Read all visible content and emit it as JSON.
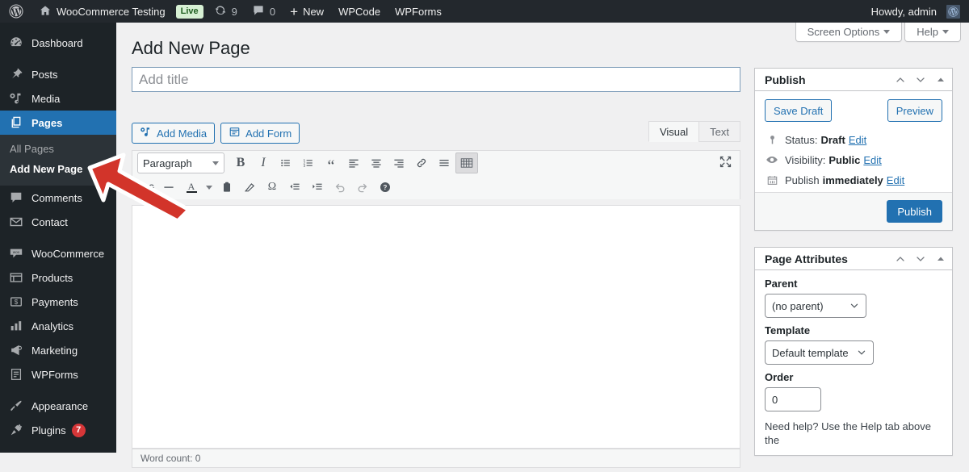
{
  "adminbar": {
    "wp_logo": "wordpress-logo-icon",
    "site_name": "WooCommerce Testing",
    "live_badge": "Live",
    "updates_icon": "updates-icon",
    "updates_count": "9",
    "comments_icon": "comment-bubble-icon",
    "comments_count": "0",
    "new_plus": "+",
    "new_label": "New",
    "wpcode_label": "WPCode",
    "wpforms_label": "WPForms",
    "howdy": "Howdy, admin",
    "avatar": "user-avatar"
  },
  "sidebar": {
    "items": [
      {
        "label": "Dashboard",
        "icon": "dashboard-icon",
        "current": false
      },
      {
        "label": "Posts",
        "icon": "pin-icon",
        "current": false
      },
      {
        "label": "Media",
        "icon": "media-icon",
        "current": false
      },
      {
        "label": "Pages",
        "icon": "pages-icon",
        "current": true
      },
      {
        "label": "Comments",
        "icon": "comment-icon",
        "current": false
      },
      {
        "label": "Contact",
        "icon": "envelope-icon",
        "current": false
      },
      {
        "label": "WooCommerce",
        "icon": "woocommerce-icon",
        "current": false
      },
      {
        "label": "Products",
        "icon": "products-icon",
        "current": false
      },
      {
        "label": "Payments",
        "icon": "payments-icon",
        "current": false
      },
      {
        "label": "Analytics",
        "icon": "analytics-icon",
        "current": false
      },
      {
        "label": "Marketing",
        "icon": "megaphone-icon",
        "current": false
      },
      {
        "label": "WPForms",
        "icon": "wpforms-icon",
        "current": false
      },
      {
        "label": "Appearance",
        "icon": "paintbrush-icon",
        "current": false
      },
      {
        "label": "Plugins",
        "icon": "plug-icon",
        "current": false,
        "count": "7"
      }
    ],
    "pages_submenu": [
      {
        "label": "All Pages",
        "current": false
      },
      {
        "label": "Add New Page",
        "current": true
      }
    ]
  },
  "screen_meta": {
    "screen_options": "Screen Options",
    "help": "Help"
  },
  "page": {
    "heading": "Add New Page",
    "title_placeholder": "Add title",
    "title_value": ""
  },
  "editor": {
    "add_media": "Add Media",
    "add_media_icon": "add-media-icon",
    "add_form": "Add Form",
    "add_form_icon": "add-form-icon",
    "tabs": [
      {
        "label": "Visual",
        "active": true
      },
      {
        "label": "Text",
        "active": false
      }
    ],
    "format_select": "Paragraph",
    "toolbar_row1": [
      {
        "name": "bold-icon",
        "glyph": "B"
      },
      {
        "name": "italic-icon",
        "glyph": "I"
      },
      {
        "name": "bulleted-list-icon",
        "glyph": "☰"
      },
      {
        "name": "numbered-list-icon",
        "glyph": "≡"
      },
      {
        "name": "blockquote-icon",
        "glyph": "“"
      },
      {
        "name": "align-left-icon",
        "glyph": "≡"
      },
      {
        "name": "align-center-icon",
        "glyph": "≡"
      },
      {
        "name": "align-right-icon",
        "glyph": "≡"
      },
      {
        "name": "insert-link-icon",
        "glyph": "🔗"
      },
      {
        "name": "read-more-icon",
        "glyph": "—"
      },
      {
        "name": "toolbar-toggle-icon",
        "glyph": "⌨"
      }
    ],
    "toolbar_row2": [
      {
        "name": "strikethrough-icon",
        "glyph": "ABC"
      },
      {
        "name": "horizontal-line-icon",
        "glyph": "—"
      },
      {
        "name": "text-color-icon",
        "glyph": "A"
      },
      {
        "name": "paste-as-text-icon",
        "glyph": "📋"
      },
      {
        "name": "clear-formatting-icon",
        "glyph": "⊘"
      },
      {
        "name": "special-character-icon",
        "glyph": "Ω"
      },
      {
        "name": "decrease-indent-icon",
        "glyph": "⇤"
      },
      {
        "name": "increase-indent-icon",
        "glyph": "⇥"
      },
      {
        "name": "undo-icon",
        "glyph": "↶"
      },
      {
        "name": "redo-icon",
        "glyph": "↷"
      },
      {
        "name": "keyboard-shortcuts-icon",
        "glyph": "?"
      }
    ],
    "fullscreen_icon": "distraction-free-icon",
    "content_value": "",
    "status_info": "Word count: 0"
  },
  "publish_box": {
    "title": "Publish",
    "save_draft": "Save Draft",
    "preview": "Preview",
    "status_icon": "pin-status-icon",
    "status_label": "Status:",
    "status_value": "Draft",
    "status_edit": "Edit",
    "visibility_icon": "eye-icon",
    "visibility_label": "Visibility:",
    "visibility_value": "Public",
    "visibility_edit": "Edit",
    "schedule_icon": "calendar-icon",
    "schedule_label": "Publish",
    "schedule_value": "immediately",
    "schedule_edit": "Edit",
    "publish_button": "Publish"
  },
  "page_attributes": {
    "title": "Page Attributes",
    "parent_label": "Parent",
    "parent_value": "(no parent)",
    "template_label": "Template",
    "template_value": "Default template",
    "order_label": "Order",
    "order_value": "0",
    "help_note": "Need help? Use the Help tab above the"
  },
  "colors": {
    "wp_blue": "#2271b1",
    "sidebar_bg": "#1d2327",
    "adminbar_bg": "#23282d",
    "annotation_red": "#d2342a",
    "badge_red": "#d63638",
    "live_green": "#d7f0d4"
  },
  "annotation": {
    "arrow": "red-arrow-pointing-to-add-new-page"
  }
}
